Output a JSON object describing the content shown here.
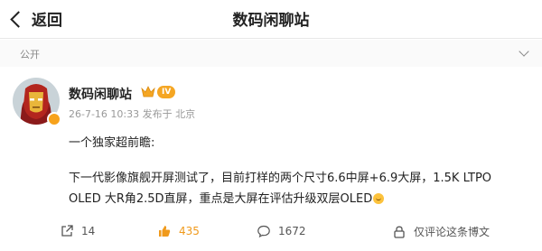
{
  "header": {
    "back_label": "返回",
    "title": "数码闲聊站"
  },
  "visibility": {
    "label": "公开"
  },
  "post": {
    "author": "数码闲聊站",
    "level_badge": "IV",
    "meta": "26-7-16 10:33 发布于 北京",
    "line1": "一个独家超前瞻:",
    "line2": "下一代影像旗舰开屏测试了，目前打样的两个尺寸6.6中屏+6.9大屏，1.5K LTPO",
    "line3": "OLED 大R角2.5D直屏，重点是大屏在评估升级双层OLED"
  },
  "actions": {
    "repost_count": "14",
    "like_count": "435",
    "comment_count": "1672",
    "permission_text": "仅评论这条博文"
  },
  "colors": {
    "like_accent": "#f09a1c",
    "badge_gold": "#f5a623",
    "verified": "#f7a21b"
  }
}
